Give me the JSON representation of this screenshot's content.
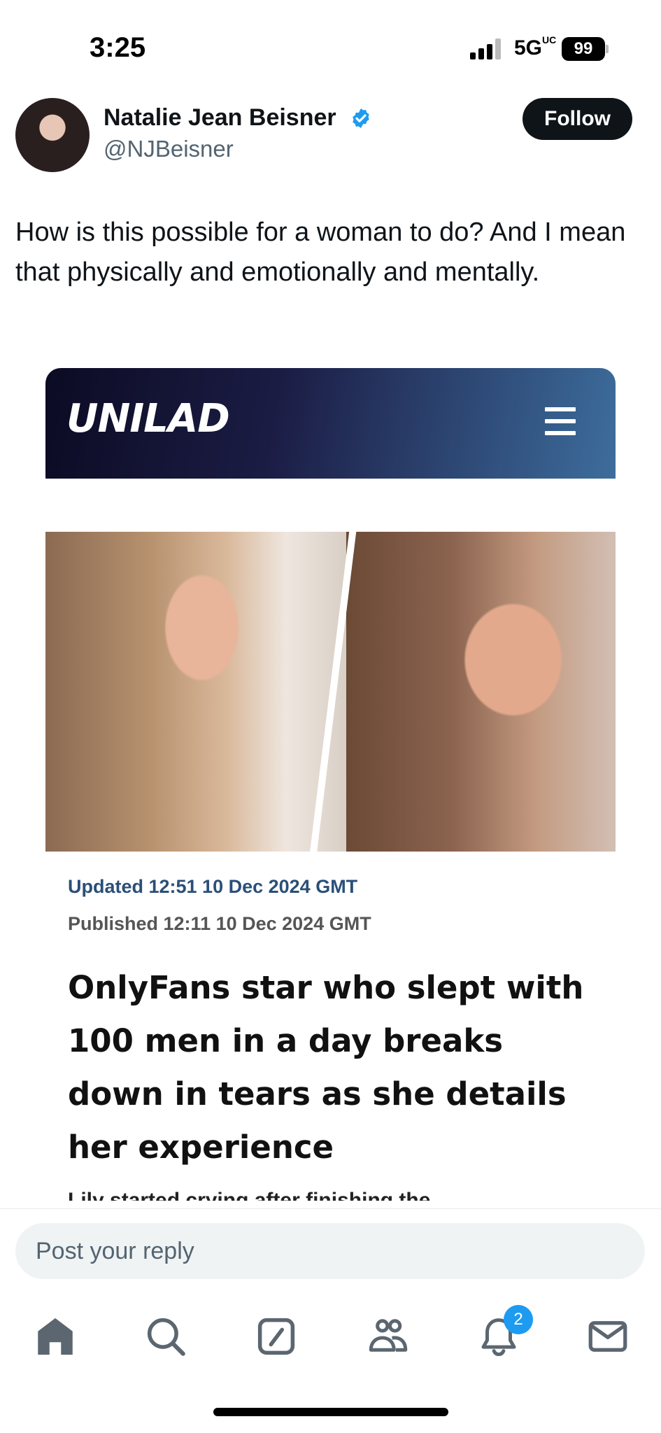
{
  "status_bar": {
    "time": "3:25",
    "network": "5G",
    "network_suffix": "UC",
    "battery": "99"
  },
  "post": {
    "author_name": "Natalie Jean Beisner",
    "handle": "@NJBeisner",
    "follow_label": "Follow",
    "text": "How is this possible for a woman to do? And I mean that physically and emotionally and mentally."
  },
  "article": {
    "brand": "UNILAD",
    "updated": "Updated 12:51 10 Dec 2024 GMT",
    "published": "Published 12:11 10 Dec 2024 GMT",
    "headline": "OnlyFans star who slept with 100 men in a day breaks down in tears as she details her experience",
    "teaser": "Lily started crying after finishing the"
  },
  "reply": {
    "placeholder": "Post your reply"
  },
  "nav": {
    "items": [
      "home-icon",
      "search-icon",
      "grok-icon",
      "communities-icon",
      "notifications-icon",
      "messages-icon"
    ],
    "notification_count": "2"
  },
  "colors": {
    "accent": "#1d9bf0",
    "text": "#0f1419",
    "secondary": "#536471",
    "updated": "#2a4f79"
  }
}
